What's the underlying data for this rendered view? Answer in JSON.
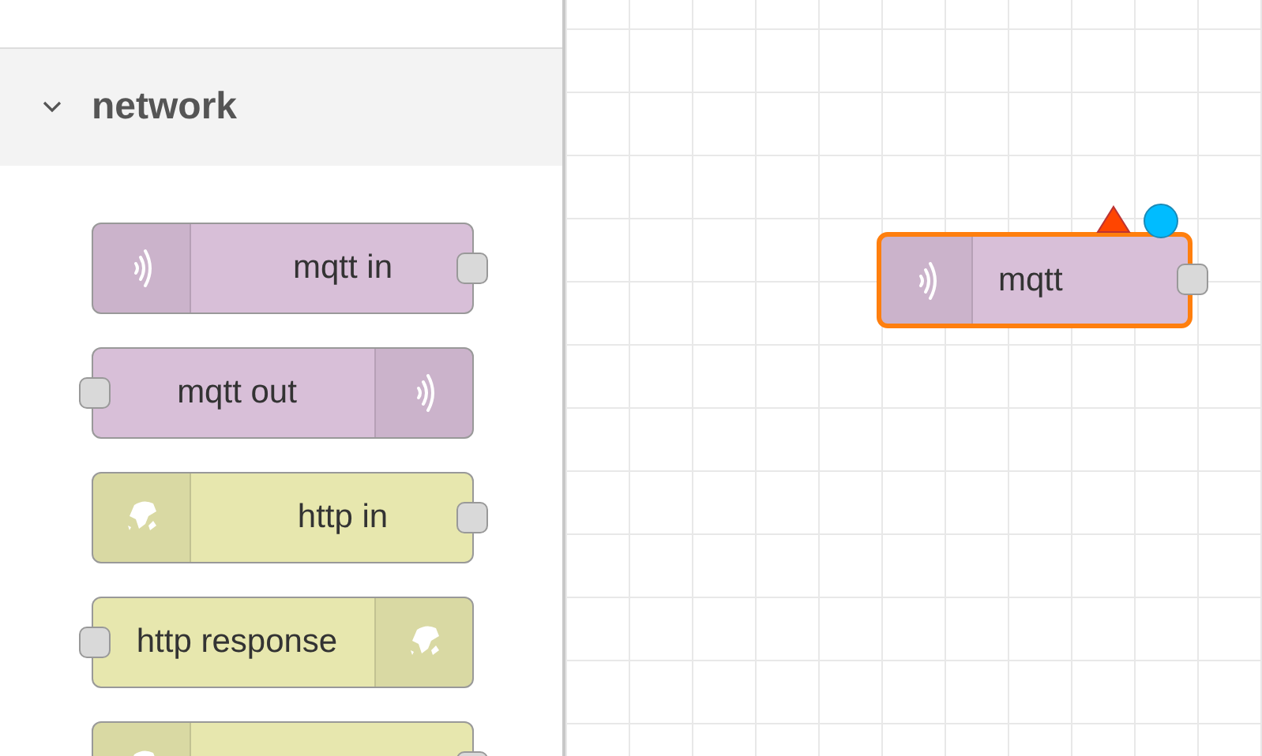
{
  "palette": {
    "category": {
      "label": "network",
      "expanded": true
    },
    "nodes": [
      {
        "label": "mqtt in",
        "kind": "mqttin",
        "color": "#d8bfd8"
      },
      {
        "label": "mqtt out",
        "kind": "mqttout",
        "color": "#d8bfd8"
      },
      {
        "label": "http in",
        "kind": "httpin",
        "color": "#e7e7ae"
      },
      {
        "label": "http response",
        "kind": "httpout",
        "color": "#e7e7ae"
      },
      {
        "kind": "httpin",
        "color": "#e7e7ae"
      }
    ]
  },
  "canvas": {
    "nodes": [
      {
        "label": "mqtt",
        "kind": "mqttin",
        "color": "#d8bfd8",
        "selected": true,
        "error": true,
        "changed": true
      }
    ]
  }
}
